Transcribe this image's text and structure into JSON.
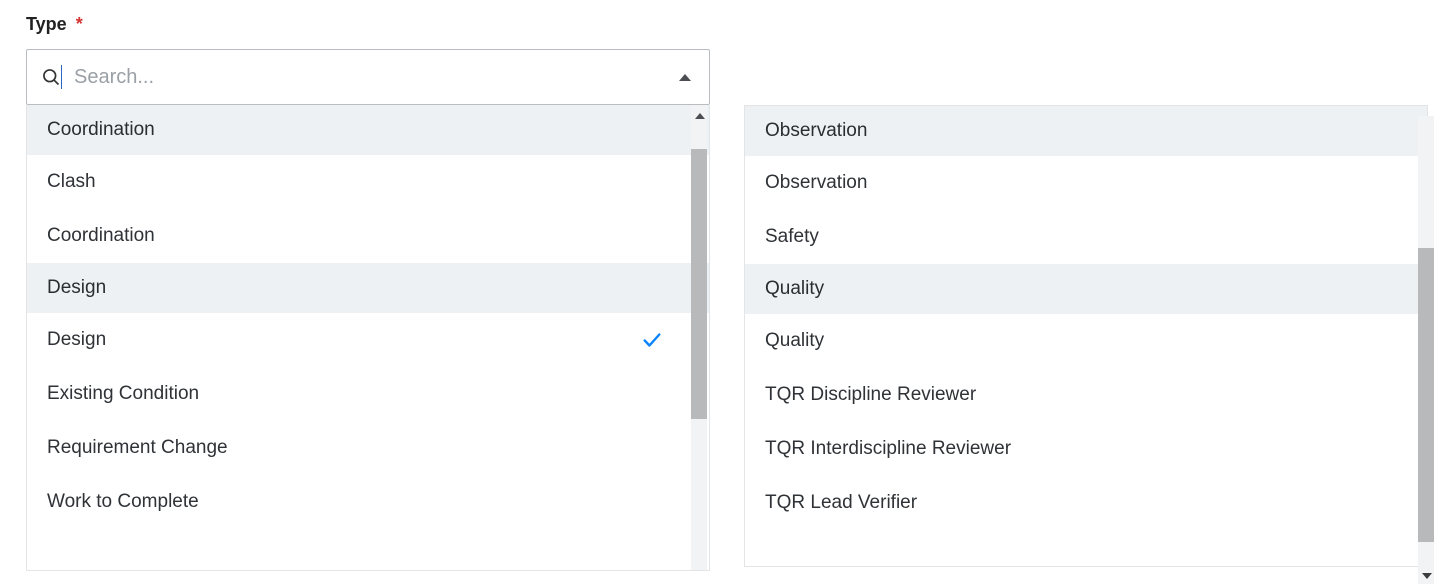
{
  "field": {
    "label": "Type",
    "required_marker": "*"
  },
  "search": {
    "placeholder": "Search...",
    "value": ""
  },
  "left": {
    "groups": [
      {
        "name": "Coordination",
        "items": [
          {
            "label": "Clash",
            "selected": false
          },
          {
            "label": "Coordination",
            "selected": false
          }
        ]
      },
      {
        "name": "Design",
        "items": [
          {
            "label": "Design",
            "selected": true
          },
          {
            "label": "Existing Condition",
            "selected": false
          },
          {
            "label": "Requirement Change",
            "selected": false
          },
          {
            "label": "Work to Complete",
            "selected": false
          }
        ]
      }
    ]
  },
  "right": {
    "groups": [
      {
        "name": "Observation",
        "items": [
          {
            "label": "Observation",
            "selected": false
          },
          {
            "label": "Safety",
            "selected": false
          }
        ]
      },
      {
        "name": "Quality",
        "items": [
          {
            "label": "Quality",
            "selected": false
          },
          {
            "label": "TQR Discipline Reviewer",
            "selected": false
          },
          {
            "label": "TQR Interdiscipline Reviewer",
            "selected": false
          },
          {
            "label": "TQR Lead Verifier",
            "selected": false
          }
        ]
      }
    ]
  }
}
